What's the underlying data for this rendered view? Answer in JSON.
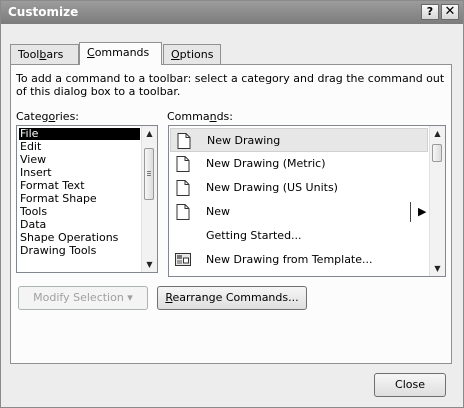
{
  "window": {
    "title": "Customize",
    "help_button": "?",
    "close_button": "✕"
  },
  "tabs": [
    {
      "label_pre": "Tool",
      "label_key": "b",
      "label_post": "ars",
      "active": false
    },
    {
      "label_pre": "",
      "label_key": "C",
      "label_post": "ommands",
      "active": true
    },
    {
      "label_pre": "",
      "label_key": "O",
      "label_post": "ptions",
      "active": false
    }
  ],
  "instructions": "To add a command to a toolbar: select a category and drag the command out of this dialog box to a toolbar.",
  "categories_label": {
    "pre": "Categ",
    "key": "o",
    "post": "ries:"
  },
  "commands_label": {
    "pre": "Comma",
    "key": "n",
    "post": "ds:"
  },
  "categories": {
    "selected": "File",
    "items": [
      "File",
      "Edit",
      "View",
      "Insert",
      "Format Text",
      "Format Shape",
      "Tools",
      "Data",
      "Shape Operations",
      "Drawing Tools"
    ]
  },
  "commands": {
    "selected": "New Drawing",
    "items": [
      {
        "label": "New Drawing",
        "icon": "blank-document-icon",
        "submenu": false
      },
      {
        "label": "New Drawing (Metric)",
        "icon": "blank-document-icon",
        "submenu": false
      },
      {
        "label": "New Drawing (US Units)",
        "icon": "blank-document-icon",
        "submenu": false
      },
      {
        "label": "New",
        "icon": "blank-document-icon",
        "submenu": true
      },
      {
        "label": "Getting Started...",
        "icon": "",
        "submenu": false
      },
      {
        "label": "New Drawing from Template...",
        "icon": "template-document-icon",
        "submenu": false
      }
    ]
  },
  "buttons": {
    "modify_selection": "Modify Selection ▾",
    "rearrange": {
      "pre": "",
      "key": "R",
      "post": "earrange Commands..."
    },
    "close": "Close"
  },
  "colors": {
    "titlebar": "#8a8a8a",
    "selection_bg": "#000000",
    "selection_fg": "#ffffff",
    "dialog_bg": "#ededed"
  }
}
